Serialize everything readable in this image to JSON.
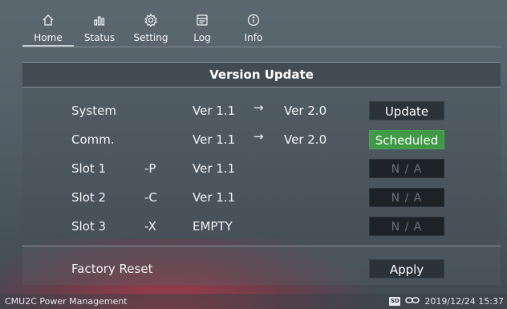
{
  "nav": {
    "items": [
      {
        "label": "Home",
        "icon": "home-icon",
        "active": true
      },
      {
        "label": "Status",
        "icon": "bar-chart-icon"
      },
      {
        "label": "Setting",
        "icon": "gear-icon"
      },
      {
        "label": "Log",
        "icon": "log-icon"
      },
      {
        "label": "Info",
        "icon": "info-icon"
      }
    ]
  },
  "panel": {
    "title": "Version Update",
    "rows": [
      {
        "name": "System",
        "suffix": "",
        "current": "Ver 1.1",
        "arrow": "→",
        "target": "Ver 2.0",
        "action": "Update"
      },
      {
        "name": "Comm.",
        "suffix": "",
        "current": "Ver 1.1",
        "arrow": "→",
        "target": "Ver 2.0",
        "action": "Scheduled"
      },
      {
        "name": "Slot 1",
        "suffix": "-P",
        "current": "Ver 1.1",
        "arrow": "",
        "target": "",
        "action": "N / A"
      },
      {
        "name": "Slot 2",
        "suffix": "-C",
        "current": "Ver 1.1",
        "arrow": "",
        "target": "",
        "action": "N / A"
      },
      {
        "name": "Slot 3",
        "suffix": "-X",
        "current": "EMPTY",
        "arrow": "",
        "target": "",
        "action": "N / A"
      }
    ]
  },
  "factory": {
    "label": "Factory Reset",
    "action": "Apply"
  },
  "statusbar": {
    "app_name": "CMU2C Power Management",
    "sd_label": "SD",
    "datetime": "2019/12/24 15:37"
  },
  "colors": {
    "scheduled": "#3f9a45",
    "accent_bg": "#c4374b"
  }
}
